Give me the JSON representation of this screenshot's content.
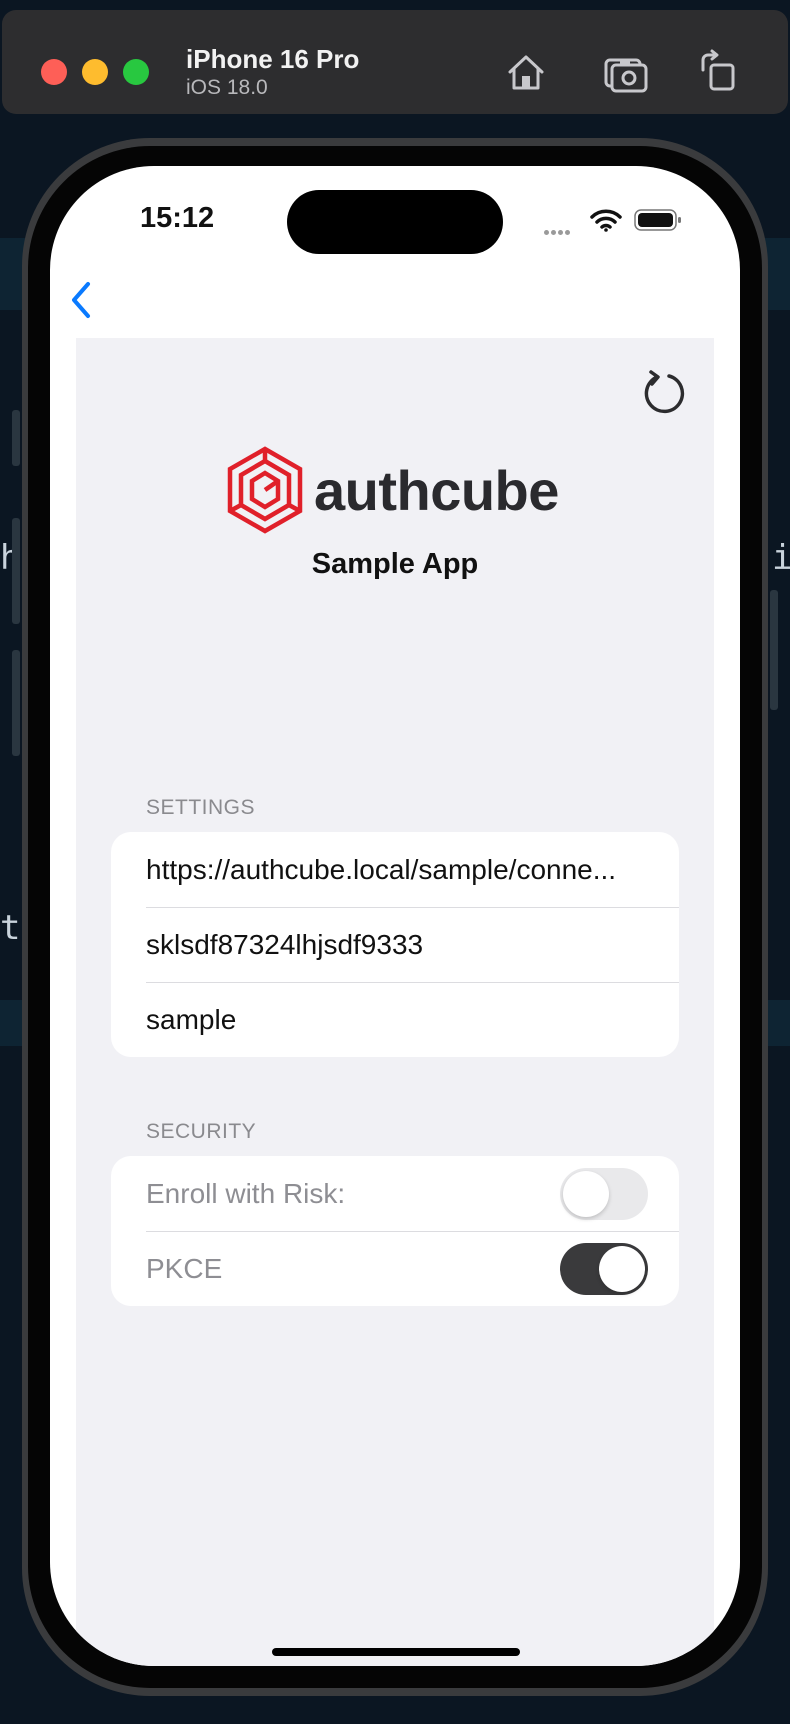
{
  "simulator": {
    "device_name": "iPhone 16 Pro",
    "os_version": "iOS 18.0",
    "buttons": [
      "home-icon",
      "screenshot-icon",
      "rotate-icon"
    ]
  },
  "status_bar": {
    "time": "15:12"
  },
  "app": {
    "brand": "authcube",
    "brand_color": "#e0202a",
    "title": "Sample App"
  },
  "settings": {
    "header": "SETTINGS",
    "rows": [
      "https://authcube.local/sample/conne...",
      "sklsdf87324lhjsdf9333",
      "sample"
    ]
  },
  "security": {
    "header": "SECURITY",
    "rows": [
      {
        "label": "Enroll with Risk:",
        "on": false
      },
      {
        "label": "PKCE",
        "on": true
      }
    ]
  },
  "colors": {
    "accent": "#0a7aff",
    "toggle_on": "#3a3a3c",
    "toggle_off": "#e9e9eb"
  }
}
